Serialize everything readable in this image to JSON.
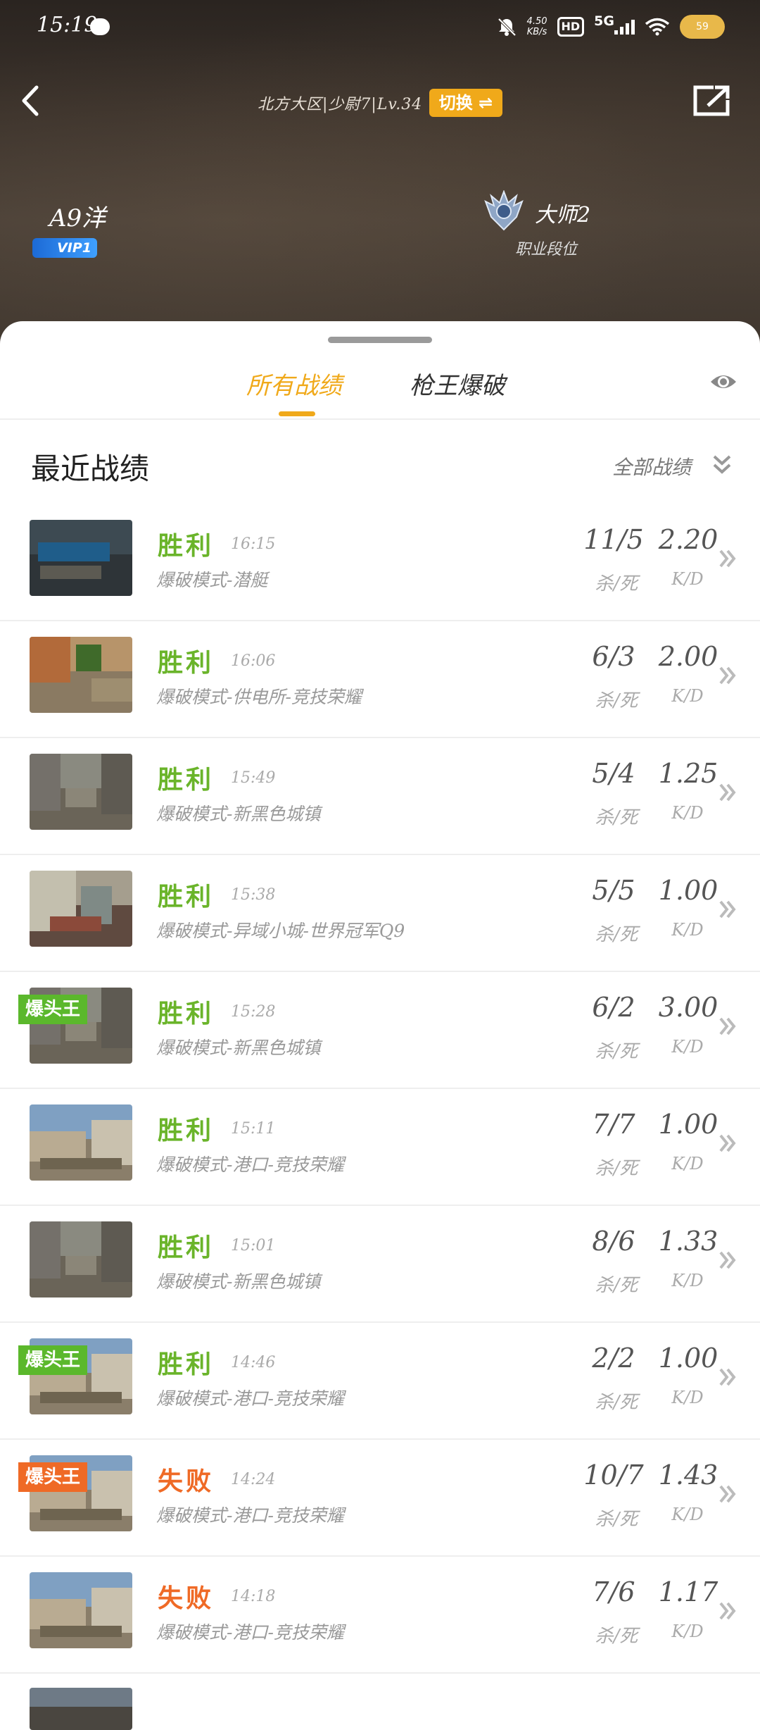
{
  "status_bar": {
    "time": "15:19",
    "net_speed_value": "4.50",
    "net_speed_unit": "KB/s",
    "hd": "HD",
    "network": "5G",
    "battery": "59"
  },
  "header": {
    "server_info": "北方大区|少尉7|Lv.34",
    "switch_label": "切换 ⇌",
    "player_name": "A9洋",
    "vip_label": "VIP1",
    "rank_name": "大师2",
    "rank_subtitle": "职业段位"
  },
  "tabs": [
    {
      "label": "所有战绩",
      "active": true
    },
    {
      "label": "枪王爆破",
      "active": false
    }
  ],
  "section": {
    "title": "最近战绩",
    "filter_label": "全部战绩"
  },
  "colors": {
    "accent": "#f0a91a",
    "win": "#6ab42a",
    "lose": "#ef6a26"
  },
  "matches": [
    {
      "result": "胜利",
      "outcome": "win",
      "time": "16:15",
      "mode": "爆破模式-潜艇",
      "kd": "11/5",
      "kd_label": "杀/死",
      "ratio": "2.20",
      "ratio_label": "K/D",
      "badge": "",
      "scene": "sub"
    },
    {
      "result": "胜利",
      "outcome": "win",
      "time": "16:06",
      "mode": "爆破模式-供电所-竞技荣耀",
      "kd": "6/3",
      "kd_label": "杀/死",
      "ratio": "2.00",
      "ratio_label": "K/D",
      "badge": "",
      "scene": "power"
    },
    {
      "result": "胜利",
      "outcome": "win",
      "time": "15:49",
      "mode": "爆破模式-新黑色城镇",
      "kd": "5/4",
      "kd_label": "杀/死",
      "ratio": "1.25",
      "ratio_label": "K/D",
      "badge": "",
      "scene": "town"
    },
    {
      "result": "胜利",
      "outcome": "win",
      "time": "15:38",
      "mode": "爆破模式-异域小城-世界冠军Q9",
      "kd": "5/5",
      "kd_label": "杀/死",
      "ratio": "1.00",
      "ratio_label": "K/D",
      "badge": "",
      "scene": "exotic"
    },
    {
      "result": "胜利",
      "outcome": "win",
      "time": "15:28",
      "mode": "爆破模式-新黑色城镇",
      "kd": "6/2",
      "kd_label": "杀/死",
      "ratio": "3.00",
      "ratio_label": "K/D",
      "badge": "爆头王",
      "badge_color": "#5bb82c",
      "scene": "town"
    },
    {
      "result": "胜利",
      "outcome": "win",
      "time": "15:11",
      "mode": "爆破模式-港口-竞技荣耀",
      "kd": "7/7",
      "kd_label": "杀/死",
      "ratio": "1.00",
      "ratio_label": "K/D",
      "badge": "",
      "scene": "port"
    },
    {
      "result": "胜利",
      "outcome": "win",
      "time": "15:01",
      "mode": "爆破模式-新黑色城镇",
      "kd": "8/6",
      "kd_label": "杀/死",
      "ratio": "1.33",
      "ratio_label": "K/D",
      "badge": "",
      "scene": "town"
    },
    {
      "result": "胜利",
      "outcome": "win",
      "time": "14:46",
      "mode": "爆破模式-港口-竞技荣耀",
      "kd": "2/2",
      "kd_label": "杀/死",
      "ratio": "1.00",
      "ratio_label": "K/D",
      "badge": "爆头王",
      "badge_color": "#5bb82c",
      "scene": "port"
    },
    {
      "result": "失败",
      "outcome": "lose",
      "time": "14:24",
      "mode": "爆破模式-港口-竞技荣耀",
      "kd": "10/7",
      "kd_label": "杀/死",
      "ratio": "1.43",
      "ratio_label": "K/D",
      "badge": "爆头王",
      "badge_color": "#ef6a26",
      "scene": "port"
    },
    {
      "result": "失败",
      "outcome": "lose",
      "time": "14:18",
      "mode": "爆破模式-港口-竞技荣耀",
      "kd": "7/6",
      "kd_label": "杀/死",
      "ratio": "1.17",
      "ratio_label": "K/D",
      "badge": "",
      "scene": "port"
    }
  ]
}
